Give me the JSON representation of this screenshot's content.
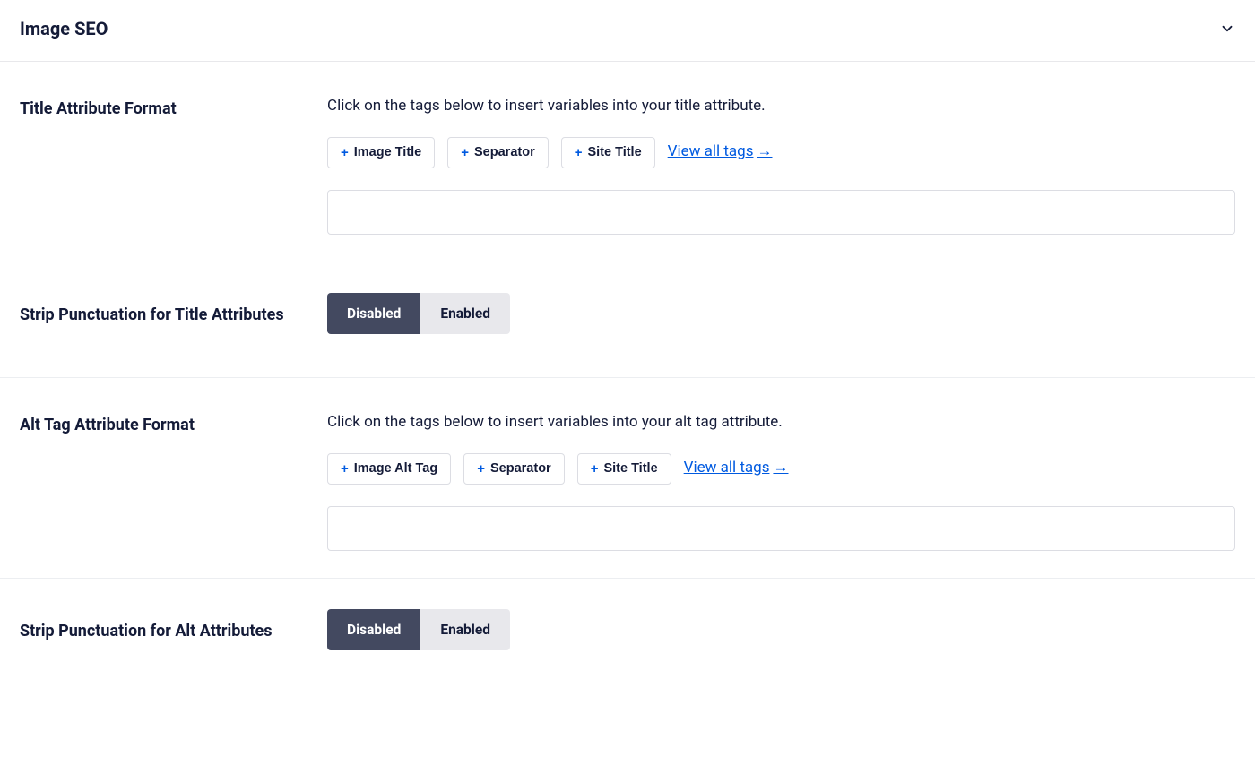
{
  "header": {
    "title": "Image SEO"
  },
  "title_format": {
    "label": "Title Attribute Format",
    "help": "Click on the tags below to insert variables into your title attribute.",
    "tags": [
      "Image Title",
      "Separator",
      "Site Title"
    ],
    "view_all": "View all tags",
    "value": ""
  },
  "title_strip": {
    "label": "Strip Punctuation for Title Attributes",
    "options": {
      "disabled": "Disabled",
      "enabled": "Enabled"
    },
    "selected": "disabled"
  },
  "alt_format": {
    "label": "Alt Tag Attribute Format",
    "help": "Click on the tags below to insert variables into your alt tag attribute.",
    "tags": [
      "Image Alt Tag",
      "Separator",
      "Site Title"
    ],
    "view_all": "View all tags",
    "value": ""
  },
  "alt_strip": {
    "label": "Strip Punctuation for Alt Attributes",
    "options": {
      "disabled": "Disabled",
      "enabled": "Enabled"
    },
    "selected": "disabled"
  }
}
